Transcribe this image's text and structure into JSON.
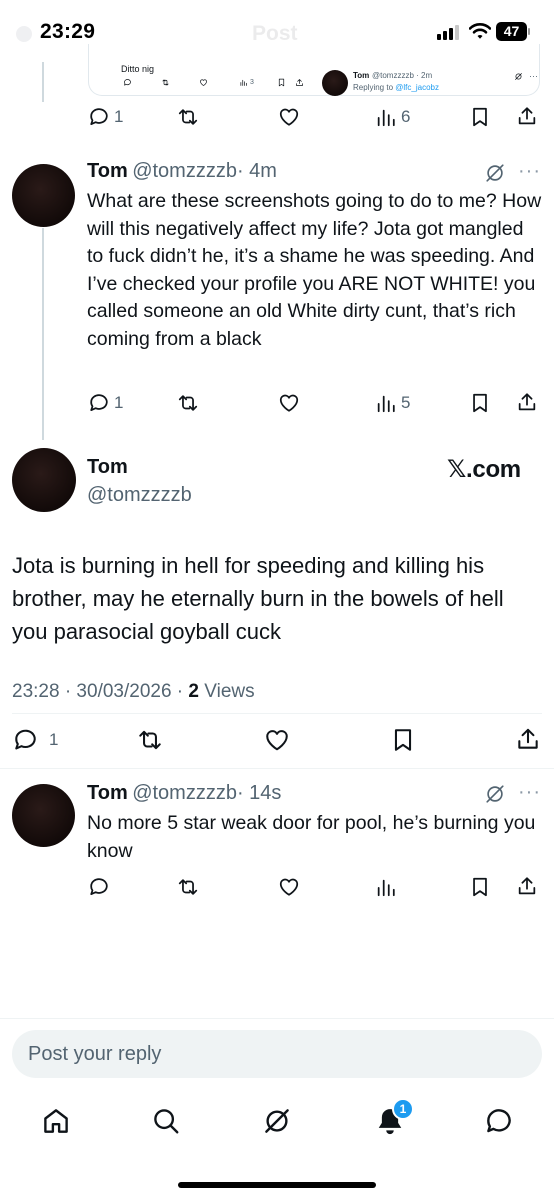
{
  "status_bar": {
    "time": "23:29",
    "header_title": "Post",
    "battery": "47"
  },
  "quoted_card": {
    "text": "Ditto nig",
    "views": "3",
    "name": "Tom",
    "handle_time": "@tomzzzzb · 2m",
    "replying_prefix": "Replying to",
    "replying_handle": "@lfc_jacobz"
  },
  "top_actions": {
    "replies": "1",
    "views": "6"
  },
  "reply1": {
    "name": "Tom",
    "handle": "@tomzzzzb",
    "time": "· 4m",
    "text": "What are these screenshots going to do to me? How will this negatively affect my life? Jota got mangled to fuck didn’t he, it’s a shame he was speeding. And I’ve checked your profile you ARE NOT WHITE! you called someone an old White dirty cunt, that’s rich coming from a black",
    "replies": "1",
    "views": "5"
  },
  "main_post": {
    "name": "Tom",
    "handle": "@tomzzzzb",
    "watermark": "𝕏.com",
    "text": "Jota is burning in hell for speeding and killing his brother, may he eternally burn in the bowels of hell you parasocial goyball cuck",
    "timestamp": "23:28 · 30/03/2026 · ",
    "views_count": "2",
    "views_label": " Views",
    "replies": "1"
  },
  "reply2": {
    "name": "Tom",
    "handle": "@tomzzzzb",
    "time": "· 14s",
    "text": "No more 5 star weak door for pool, he’s burning you know"
  },
  "composer": {
    "placeholder": "Post your reply"
  },
  "bottom_nav": {
    "notifications_badge": "1"
  },
  "colors": {
    "accent": "#1d9bf0",
    "text": "#0f1419",
    "secondary": "#536471"
  }
}
